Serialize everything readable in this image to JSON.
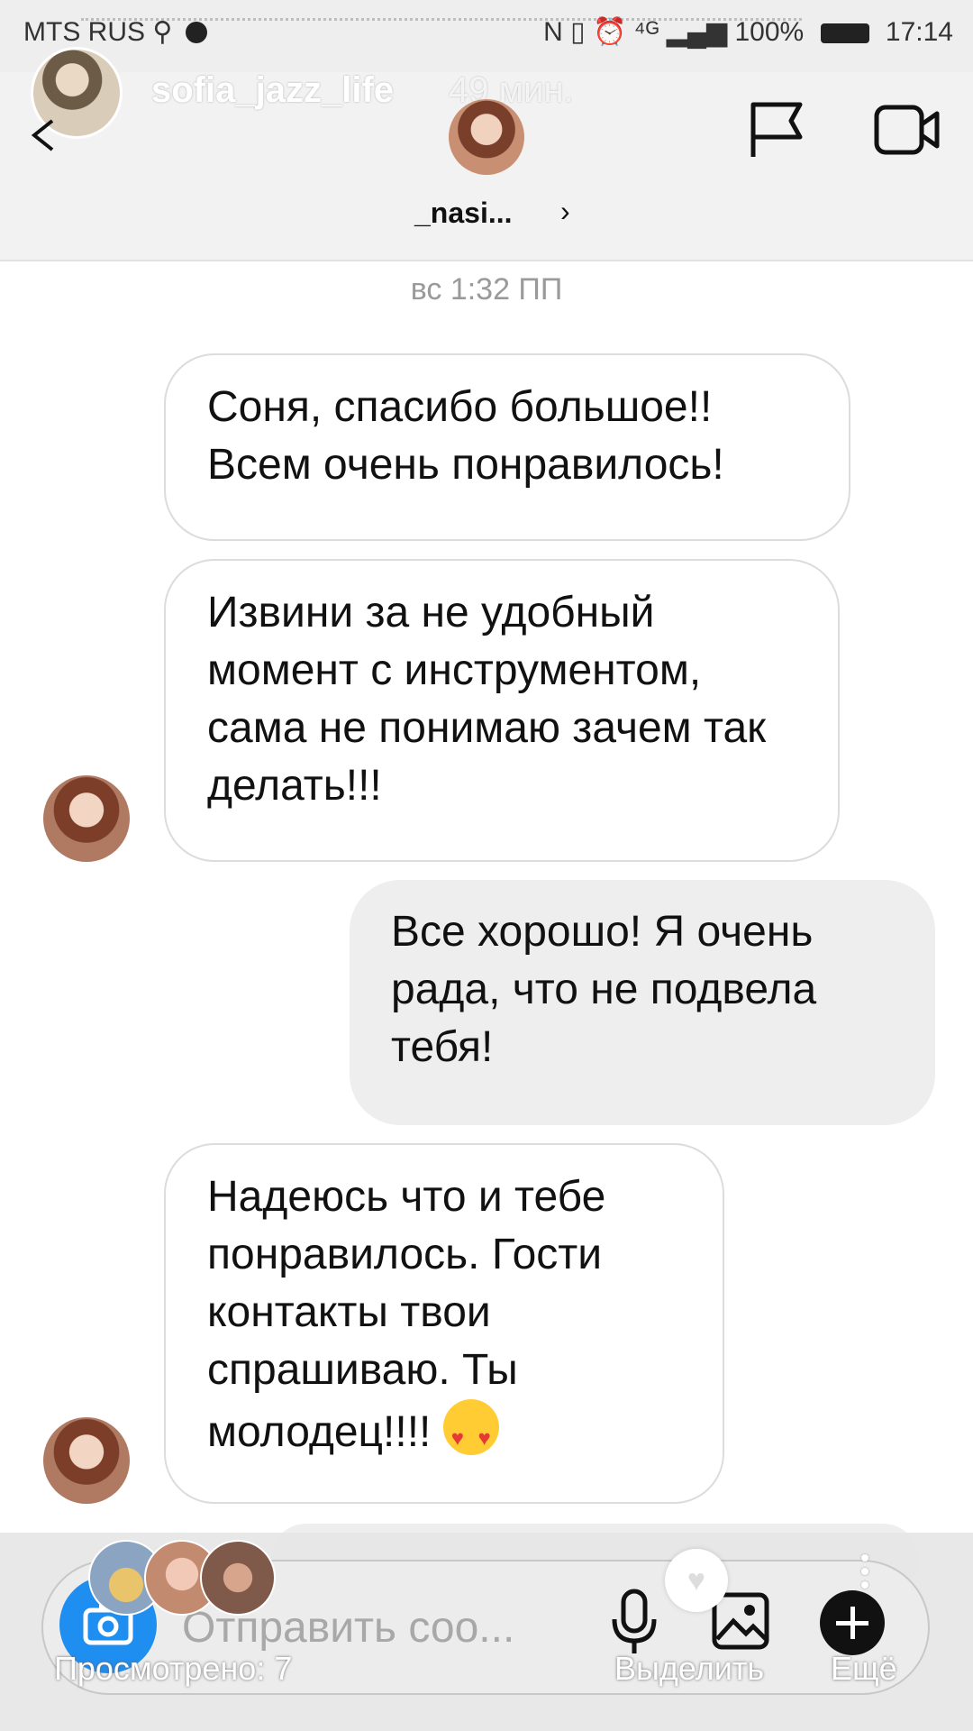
{
  "status_bar": {
    "carrier": "MTS RUS",
    "icons_right": "N ▯ ⏰ ⁴ᴳ",
    "battery": "100%",
    "time": "17:14"
  },
  "story_header": {
    "owner_name": "sofia_jazz_life",
    "time_ago": "49 мин."
  },
  "chat_header": {
    "contact_name": "_nasi...",
    "chevron": "›"
  },
  "timestamp": "вс 1:32 ПП",
  "messages": [
    {
      "direction": "incoming",
      "text": "Соня, спасибо большое!! Всем очень понравилось!"
    },
    {
      "direction": "incoming",
      "text": "Извини за не удобный момент с инструментом, сама не понимаю зачем так делать!!!"
    },
    {
      "direction": "outgoing",
      "text": "Все хорошо! Я очень рада, что не подвела тебя!"
    },
    {
      "direction": "incoming",
      "text": "Надеюсь что и тебе понравилось. Гости контакты твои спрашиваю. Ты молодец!!!!",
      "emoji": "heart-eyes"
    }
  ],
  "composer": {
    "placeholder": "Отправить соо..."
  },
  "story_footer": {
    "views": "Просмотрено: 7",
    "select": "Выделить",
    "more": "Ещё"
  },
  "colors": {
    "camera_button": "#1f8ef1",
    "outgoing_bubble": "#eeeeee",
    "incoming_border": "#dcdcdc"
  }
}
